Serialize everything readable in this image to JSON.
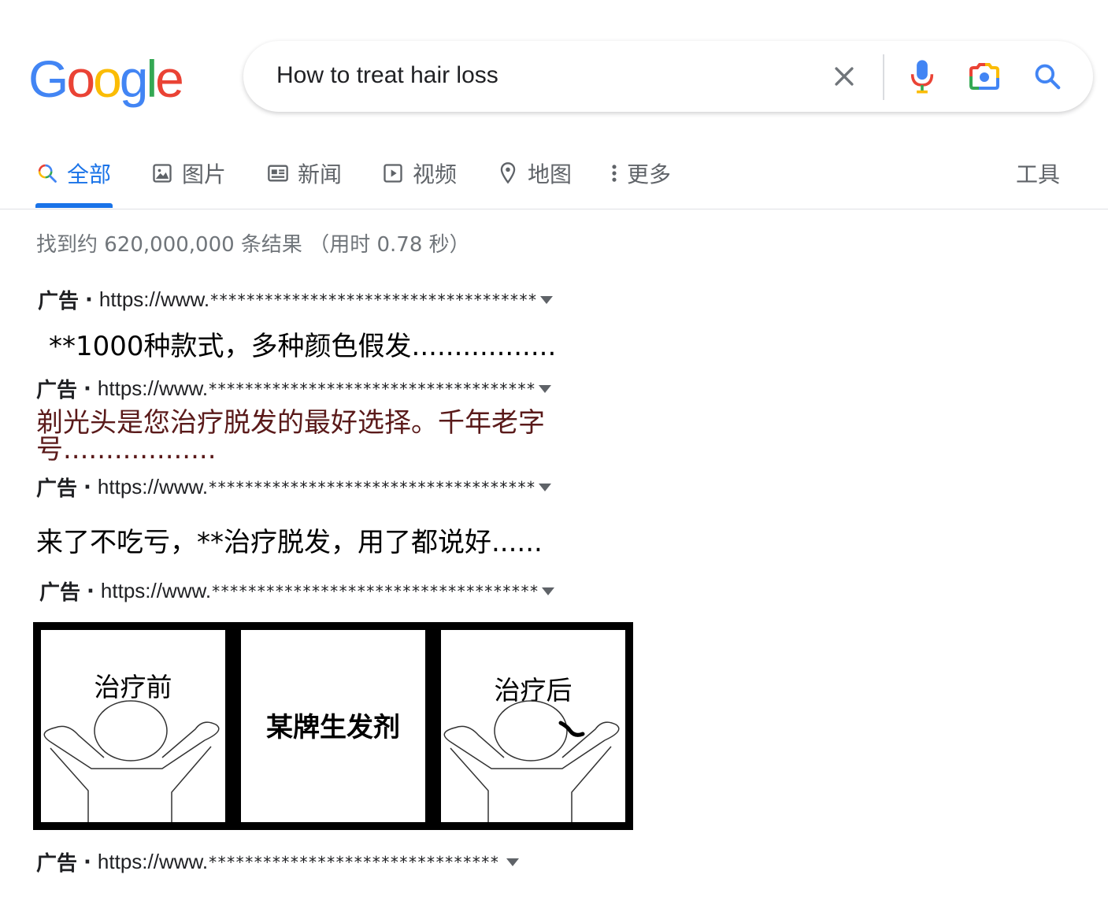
{
  "search": {
    "query": "How to treat hair loss"
  },
  "logo": {
    "letters": [
      "G",
      "o",
      "o",
      "g",
      "l",
      "e"
    ],
    "colors": [
      "#4285F4",
      "#EA4335",
      "#FBBC05",
      "#4285F4",
      "#34A853",
      "#EA4335"
    ]
  },
  "tabs": {
    "all": "全部",
    "images": "图片",
    "news": "新闻",
    "videos": "视频",
    "maps": "地图",
    "more": "更多",
    "tools": "工具"
  },
  "result_stats": "找到约 620,000,000 条结果 （用时 0.78 秒）",
  "ads": [
    {
      "label": "广告",
      "url": "https://www.",
      "masked": "************************************",
      "title": "**1000种款式，多种颜色假发.................",
      "title_color": "#000000"
    },
    {
      "label": "广告",
      "url": "https://www.",
      "masked": "************************************",
      "title_line1": "剃光头是您治疗脱发的最好选择。千年老字",
      "title_line2": "号..................",
      "title_color": "#5a1a1a"
    },
    {
      "label": "广告",
      "url": "https://www.",
      "masked": "************************************",
      "title": "来了不吃亏，**治疗脱发，用了都说好......",
      "title_color": "#000000"
    },
    {
      "label": "广告",
      "url": "https://www.",
      "masked": "************************************"
    },
    {
      "label": "广告",
      "url": "https://www.",
      "masked": "********************************"
    }
  ],
  "comic": {
    "before": "治疗前",
    "product": "某牌生发剂",
    "after": "治疗后"
  },
  "colors": {
    "accent": "#1a73e8",
    "muted": "#5f6368",
    "mic_blue": "#4285F4",
    "mic_red": "#EA4335"
  }
}
